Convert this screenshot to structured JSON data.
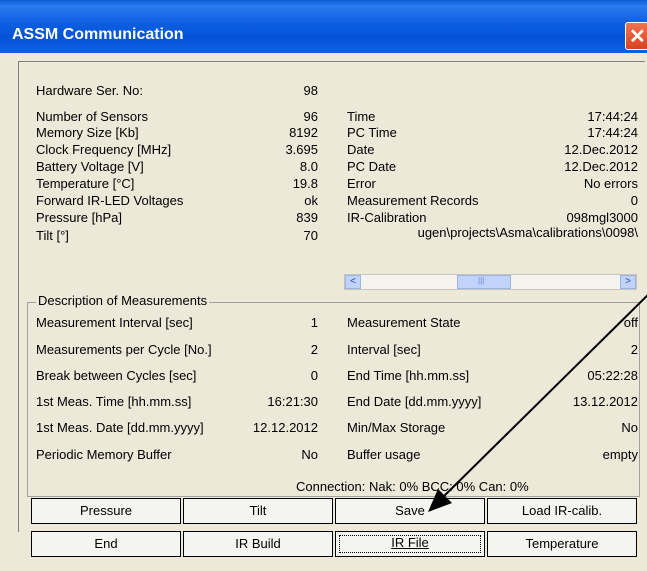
{
  "window": {
    "title": "ASSM Communication",
    "close_glyph": "✕"
  },
  "left_info": [
    {
      "label": "Hardware Ser. No:",
      "value": "98"
    },
    {
      "label": "Number of Sensors",
      "value": "96"
    },
    {
      "label": "Memory Size [Kb]",
      "value": "8192"
    },
    {
      "label": "Clock Frequency [MHz]",
      "value": "3.695"
    },
    {
      "label": "Battery Voltage [V]",
      "value": "8.0"
    },
    {
      "label": "Temperature [°C]",
      "value": "19.8"
    },
    {
      "label": "Forward IR-LED Voltages",
      "value": "ok"
    },
    {
      "label": "Pressure [hPa]",
      "value": "839"
    },
    {
      "label": "Tilt [°]",
      "value": "70"
    }
  ],
  "right_info": [
    {
      "label": "Time",
      "value": "17:44:24"
    },
    {
      "label": "PC Time",
      "value": "17:44:24"
    },
    {
      "label": "Date",
      "value": "12.Dec.2012"
    },
    {
      "label": "PC Date",
      "value": "12.Dec.2012"
    },
    {
      "label": "Error",
      "value": "No errors"
    },
    {
      "label": "Measurement Records",
      "value": "0"
    },
    {
      "label": "IR-Calibration",
      "value": "098mgl3000"
    }
  ],
  "calibration_path": "ugen\\projects\\Asma\\calibrations\\0098\\",
  "scrollbar": {
    "left_arrow": "<",
    "right_arrow": ">",
    "grip": "|||"
  },
  "description": {
    "title": "Description of Measurements",
    "left": [
      {
        "label": "Measurement Interval [sec]",
        "value": "1"
      },
      {
        "label": "Measurements per Cycle [No.]",
        "value": "2"
      },
      {
        "label": "Break between Cycles [sec]",
        "value": "0"
      },
      {
        "label": "1st Meas. Time [hh.mm.ss]",
        "value": "16:21:30"
      },
      {
        "label": "1st Meas. Date [dd.mm.yyyy]",
        "value": "12.12.2012"
      },
      {
        "label": "Periodic Memory Buffer",
        "value": "No"
      }
    ],
    "right": [
      {
        "label": "Measurement State",
        "value": "off"
      },
      {
        "label": "Interval [sec]",
        "value": "2"
      },
      {
        "label": "End Time [hh.mm.ss]",
        "value": "05:22:28"
      },
      {
        "label": "End Date [dd.mm.yyyy]",
        "value": "13.12.2012"
      },
      {
        "label": "Min/Max Storage",
        "value": "No"
      },
      {
        "label": "Buffer usage",
        "value": "empty"
      }
    ]
  },
  "connection": {
    "text": "Connection: Nak:  0% BCC:  0% Can:  0%"
  },
  "buttons": {
    "pressure": "Pressure",
    "tilt": "Tilt",
    "save": "Save",
    "load_ir_calib": "Load IR-calib.",
    "end": "End",
    "ir_build": "IR Build",
    "ir_file": "IR File",
    "temperature": "Temperature"
  }
}
